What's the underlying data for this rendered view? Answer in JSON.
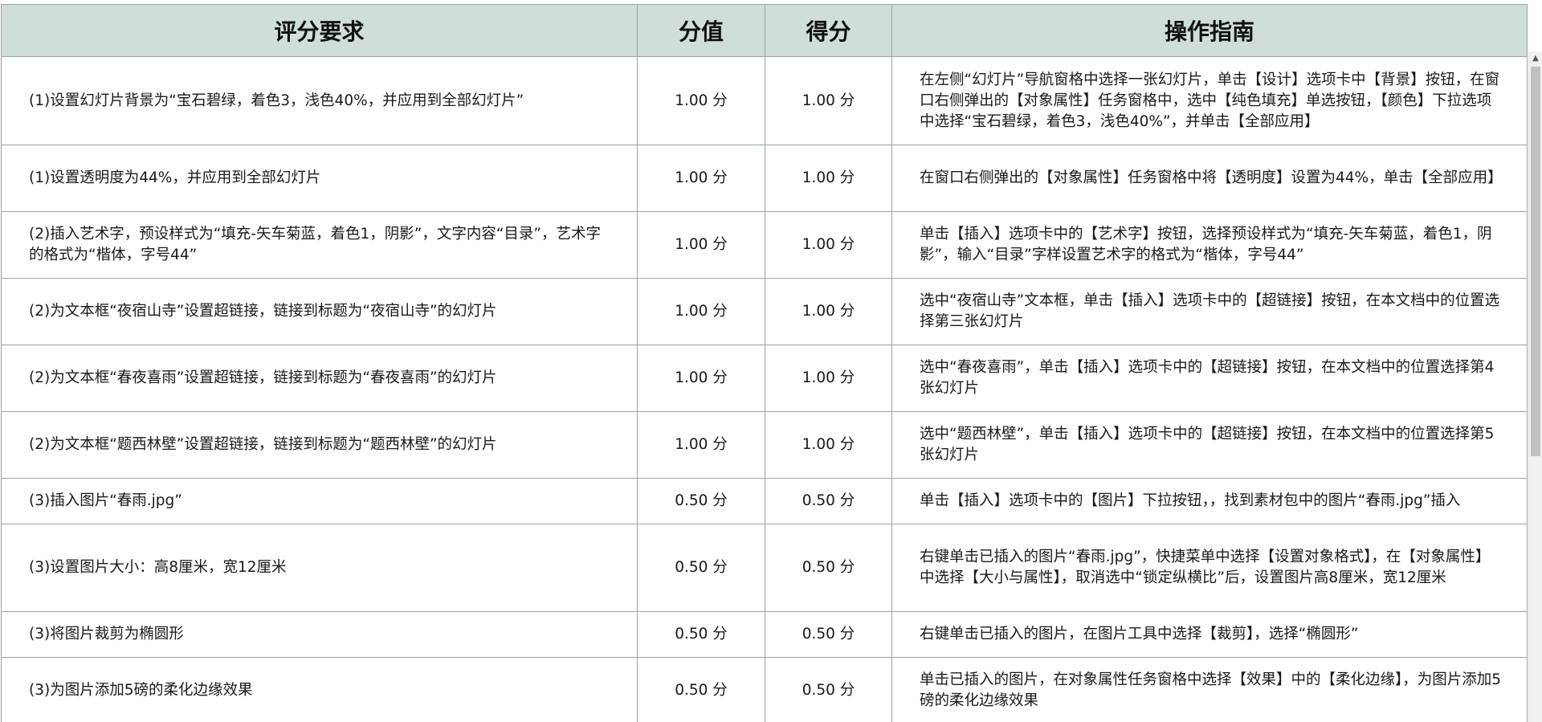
{
  "table": {
    "headers": {
      "requirement": "评分要求",
      "value": "分值",
      "score": "得分",
      "guide": "操作指南"
    },
    "rows": [
      {
        "requirement": "(1)设置幻灯片背景为“宝石碧绿，着色3，浅色40%，并应用到全部幻灯片”",
        "value": "1.00 分",
        "score": "1.00 分",
        "guide": "在左侧“幻灯片”导航窗格中选择一张幻灯片，单击【设计】选项卡中【背景】按钮，在窗口右侧弹出的【对象属性】任务窗格中，选中【纯色填充】单选按钮，【颜色】下拉选项中选择“宝石碧绿，着色3，浅色40%”，并单击【全部应用】"
      },
      {
        "requirement": "(1)设置透明度为44%，并应用到全部幻灯片",
        "value": "1.00 分",
        "score": "1.00 分",
        "guide": "在窗口右侧弹出的【对象属性】任务窗格中将【透明度】设置为44%，单击【全部应用】"
      },
      {
        "requirement": "(2)插入艺术字，预设样式为“填充-矢车菊蓝，着色1，阴影”，文字内容“目录”，艺术字的格式为“楷体，字号44”",
        "value": "1.00 分",
        "score": "1.00 分",
        "guide": "单击【插入】选项卡中的【艺术字】按钮，选择预设样式为“填充-矢车菊蓝，着色1，阴影”，输入“目录”字样设置艺术字的格式为“楷体，字号44”"
      },
      {
        "requirement": "(2)为文本框“夜宿山寺”设置超链接，链接到标题为“夜宿山寺”的幻灯片",
        "value": "1.00 分",
        "score": "1.00 分",
        "guide": "选中“夜宿山寺”文本框，单击【插入】选项卡中的【超链接】按钮，在本文档中的位置选择第三张幻灯片"
      },
      {
        "requirement": "(2)为文本框“春夜喜雨”设置超链接，链接到标题为“春夜喜雨”的幻灯片",
        "value": "1.00 分",
        "score": "1.00 分",
        "guide": "选中“春夜喜雨”，单击【插入】选项卡中的【超链接】按钮，在本文档中的位置选择第4张幻灯片"
      },
      {
        "requirement": "(2)为文本框“题西林壁”设置超链接，链接到标题为“题西林壁”的幻灯片",
        "value": "1.00 分",
        "score": "1.00 分",
        "guide": "选中“题西林壁”，单击【插入】选项卡中的【超链接】按钮，在本文档中的位置选择第5张幻灯片"
      },
      {
        "requirement": "(3)插入图片“春雨.jpg”",
        "value": "0.50 分",
        "score": "0.50 分",
        "guide": "单击【插入】选项卡中的【图片】下拉按钮，，找到素材包中的图片“春雨.jpg”插入"
      },
      {
        "requirement": "(3)设置图片大小：高8厘米，宽12厘米",
        "value": "0.50 分",
        "score": "0.50 分",
        "guide": "右键单击已插入的图片“春雨.jpg”，快捷菜单中选择【设置对象格式】，在【对象属性】中选择【大小与属性】，取消选中“锁定纵横比”后，设置图片高8厘米，宽12厘米"
      },
      {
        "requirement": "(3)将图片裁剪为椭圆形",
        "value": "0.50 分",
        "score": "0.50 分",
        "guide": "右键单击已插入的图片，在图片工具中选择【裁剪】，选择“椭圆形”"
      },
      {
        "requirement": "(3)为图片添加5磅的柔化边缘效果",
        "value": "0.50 分",
        "score": "0.50 分",
        "guide": "单击已插入的图片，在对象属性任务窗格中选择【效果】中的【柔化边缘】，为图片添加5磅的柔化边缘效果"
      }
    ]
  },
  "scrollbar": {
    "up_arrow_icon": "chevron-up-icon",
    "up_arrow_glyph": "▲"
  }
}
